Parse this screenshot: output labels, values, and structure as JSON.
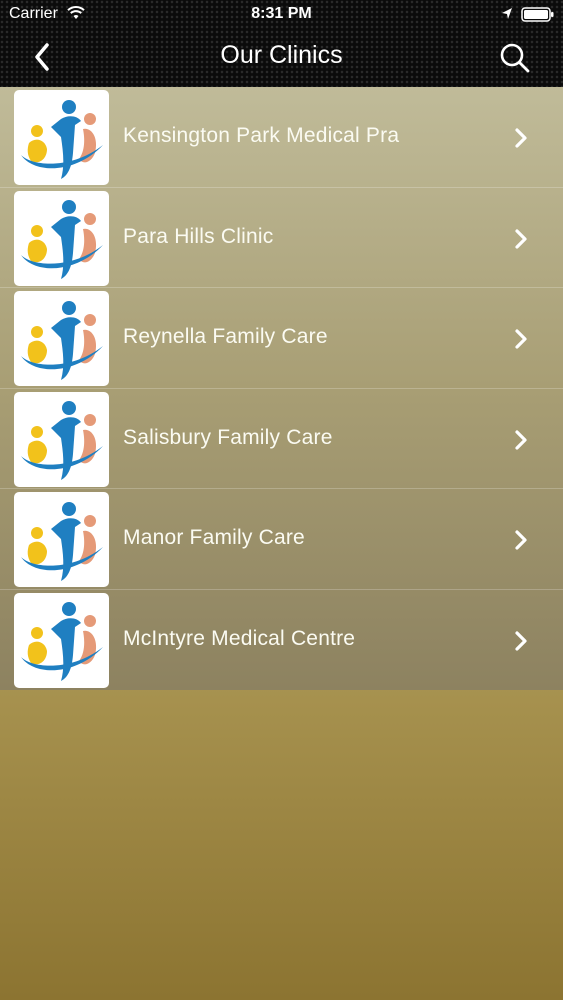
{
  "status_bar": {
    "carrier": "Carrier",
    "time": "8:31 PM"
  },
  "nav": {
    "title": "Our Clinics",
    "back_icon": "chevron-left-icon",
    "search_icon": "search-icon"
  },
  "clinics": [
    {
      "name": "Kensington Park Medical Pra"
    },
    {
      "name": "Para Hills Clinic"
    },
    {
      "name": "Reynella Family Care"
    },
    {
      "name": "Salisbury Family Care"
    },
    {
      "name": "Manor Family Care"
    },
    {
      "name": "McIntyre Medical Centre"
    }
  ],
  "colors": {
    "header_bg": "#0b0b0b",
    "list_text": "#fbfbf2",
    "logo_blue": "#1f7fc1",
    "logo_yellow": "#f2c21b",
    "logo_salmon": "#e59a78"
  }
}
